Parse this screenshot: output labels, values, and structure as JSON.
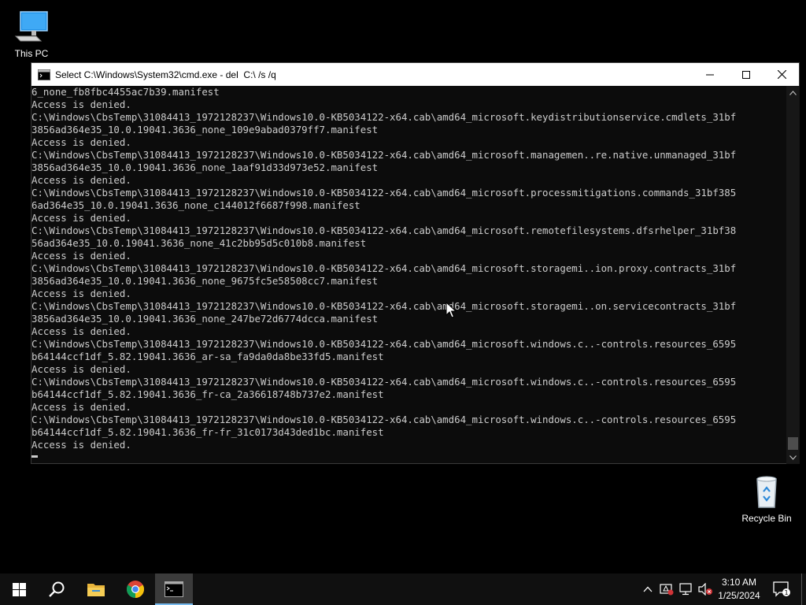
{
  "desktop": {
    "icons": [
      {
        "label": "This PC",
        "icon": "this-pc-icon"
      },
      {
        "label": "Recycle Bin",
        "icon": "recycle-bin-icon"
      }
    ]
  },
  "window": {
    "title": "Select C:\\Windows\\System32\\cmd.exe - del  C:\\ /s /q",
    "lines": [
      "6_none_fb8fbc4455ac7b39.manifest",
      "Access is denied.",
      "C:\\Windows\\CbsTemp\\31084413_1972128237\\Windows10.0-KB5034122-x64.cab\\amd64_microsoft.keydistributionservice.cmdlets_31bf",
      "3856ad364e35_10.0.19041.3636_none_109e9abad0379ff7.manifest",
      "Access is denied.",
      "C:\\Windows\\CbsTemp\\31084413_1972128237\\Windows10.0-KB5034122-x64.cab\\amd64_microsoft.managemen..re.native.unmanaged_31bf",
      "3856ad364e35_10.0.19041.3636_none_1aaf91d33d973e52.manifest",
      "Access is denied.",
      "C:\\Windows\\CbsTemp\\31084413_1972128237\\Windows10.0-KB5034122-x64.cab\\amd64_microsoft.processmitigations.commands_31bf385",
      "6ad364e35_10.0.19041.3636_none_c144012f6687f998.manifest",
      "Access is denied.",
      "C:\\Windows\\CbsTemp\\31084413_1972128237\\Windows10.0-KB5034122-x64.cab\\amd64_microsoft.remotefilesystems.dfsrhelper_31bf38",
      "56ad364e35_10.0.19041.3636_none_41c2bb95d5c010b8.manifest",
      "Access is denied.",
      "C:\\Windows\\CbsTemp\\31084413_1972128237\\Windows10.0-KB5034122-x64.cab\\amd64_microsoft.storagemi..ion.proxy.contracts_31bf",
      "3856ad364e35_10.0.19041.3636_none_9675fc5e58508cc7.manifest",
      "Access is denied.",
      "C:\\Windows\\CbsTemp\\31084413_1972128237\\Windows10.0-KB5034122-x64.cab\\amd64_microsoft.storagemi..on.servicecontracts_31bf",
      "3856ad364e35_10.0.19041.3636_none_247be72d6774dcca.manifest",
      "Access is denied.",
      "C:\\Windows\\CbsTemp\\31084413_1972128237\\Windows10.0-KB5034122-x64.cab\\amd64_microsoft.windows.c..-controls.resources_6595",
      "b64144ccf1df_5.82.19041.3636_ar-sa_fa9da0da8be33fd5.manifest",
      "Access is denied.",
      "C:\\Windows\\CbsTemp\\31084413_1972128237\\Windows10.0-KB5034122-x64.cab\\amd64_microsoft.windows.c..-controls.resources_6595",
      "b64144ccf1df_5.82.19041.3636_fr-ca_2a36618748b737e2.manifest",
      "Access is denied.",
      "C:\\Windows\\CbsTemp\\31084413_1972128237\\Windows10.0-KB5034122-x64.cab\\amd64_microsoft.windows.c..-controls.resources_6595",
      "b64144ccf1df_5.82.19041.3636_fr-fr_31c0173d43ded1bc.manifest",
      "Access is denied."
    ],
    "buttons": {
      "minimize": "minimize-icon",
      "maximize": "maximize-icon",
      "close": "close-icon"
    },
    "scroll_position": 1.0
  },
  "taskbar": {
    "items": [
      "start",
      "search",
      "file-explorer",
      "chrome",
      "command-prompt"
    ],
    "active": "command-prompt",
    "clock": {
      "time": "3:10 AM",
      "date": "1/25/2024"
    },
    "accent": "#76b9ed"
  }
}
